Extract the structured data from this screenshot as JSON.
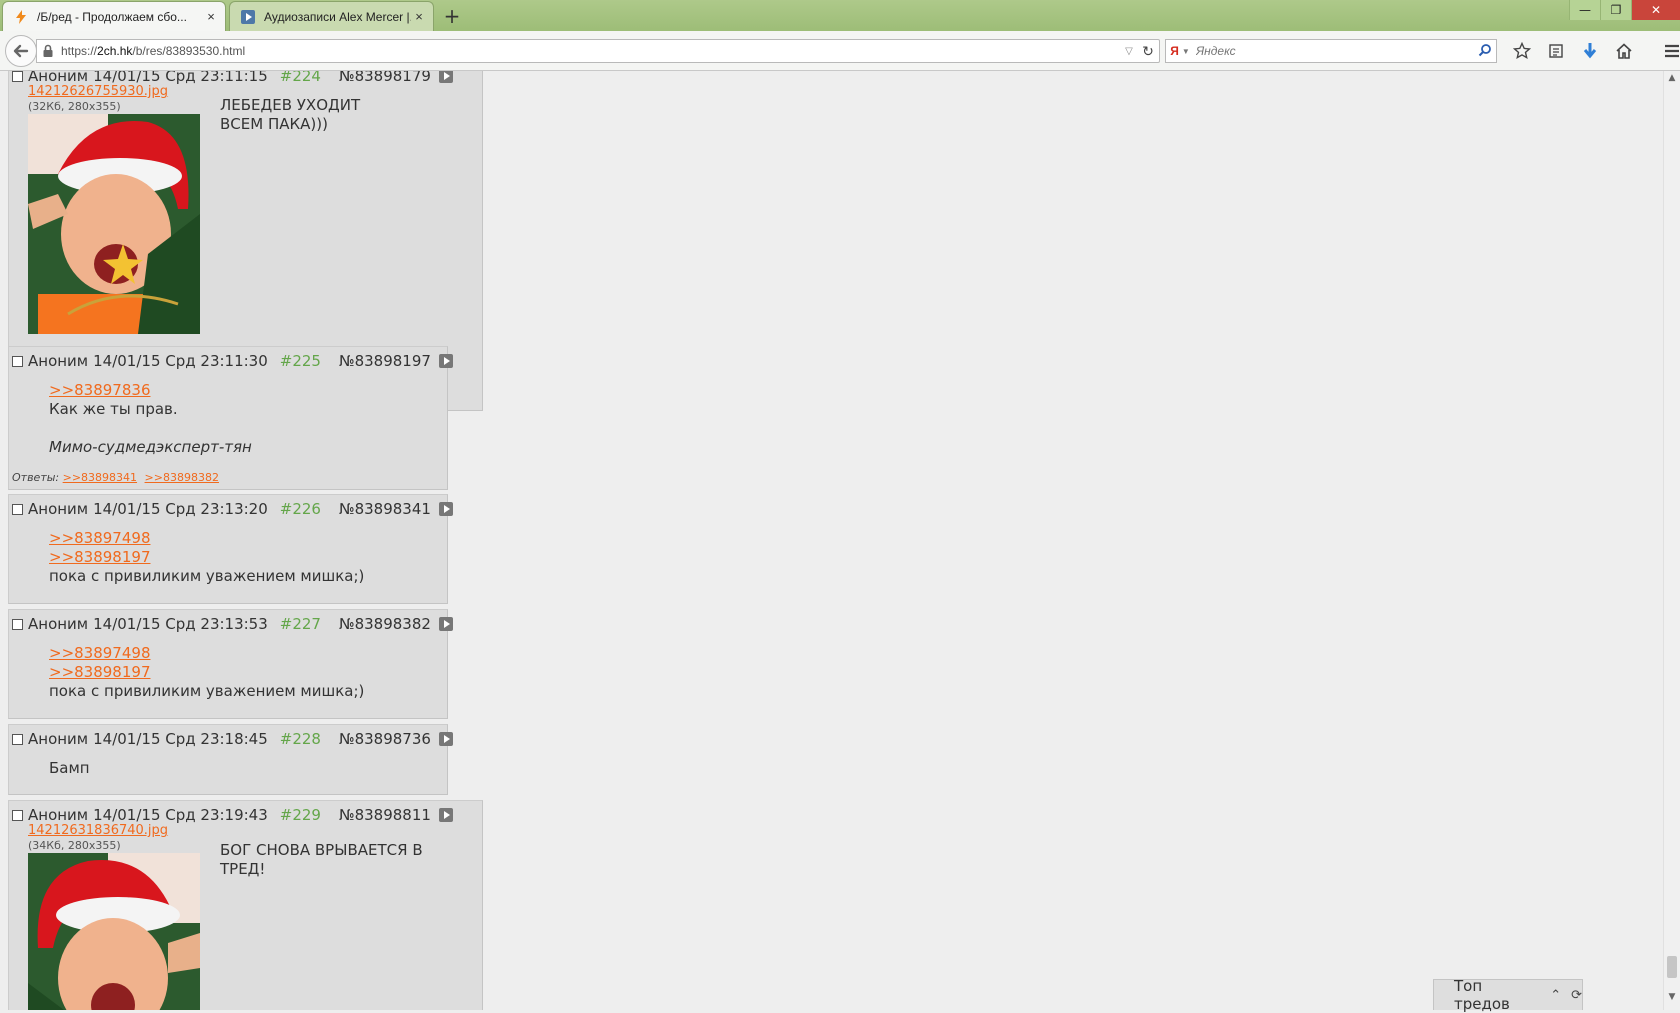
{
  "browser": {
    "tabs": [
      {
        "title": "/Б/ред - Продолжаем сбо...",
        "close": "×"
      },
      {
        "title": "Аудиозаписи Alex Mercer |...",
        "close": "×"
      }
    ],
    "new_tab": "+",
    "url_prefix": "https://",
    "url_host": "2ch.hk",
    "url_path": "/b/res/83893530.html",
    "search_placeholder": "Яндекс",
    "search_engine_letter": "Я",
    "window_buttons": {
      "minimize": "—",
      "restore": "❐",
      "close": "✕"
    }
  },
  "posts": [
    {
      "checkbox": "",
      "name": "Аноним",
      "date": "14/01/15 Срд 23:11:15",
      "num": "#224",
      "id": "№83898179",
      "file": {
        "name": "14212626755930.jpg",
        "meta": "(32Кб, 280x355)"
      },
      "lines": [
        "ЛЕБЕДЕВ УХОДИТ",
        "ВСЕМ ПАКА)))"
      ]
    },
    {
      "name": "Аноним",
      "date": "14/01/15 Срд 23:11:30",
      "num": "#225",
      "id": "№83898197",
      "refs": [
        ">>83897836"
      ],
      "text": "Как же ты прав.",
      "italic": "Мимо-судмедэксперт-тян",
      "replies_label": "Ответы:",
      "replies": [
        ">>83898341",
        ">>83898382"
      ]
    },
    {
      "name": "Аноним",
      "date": "14/01/15 Срд 23:13:20",
      "num": "#226",
      "id": "№83898341",
      "refs": [
        ">>83897498",
        ">>83898197"
      ],
      "text": "пока с привиликим уважением мишка;)"
    },
    {
      "name": "Аноним",
      "date": "14/01/15 Срд 23:13:53",
      "num": "#227",
      "id": "№83898382",
      "refs": [
        ">>83897498",
        ">>83898197"
      ],
      "text": "пока с привиликим уважением мишка;)"
    },
    {
      "name": "Аноним",
      "date": "14/01/15 Срд 23:18:45",
      "num": "#228",
      "id": "№83898736",
      "text": "Бамп"
    },
    {
      "name": "Аноним",
      "date": "14/01/15 Срд 23:19:43",
      "num": "#229",
      "id": "№83898811",
      "file": {
        "name": "14212631836740.jpg",
        "meta": "(34Кб, 280x355)"
      },
      "lines": [
        "БОГ СНОВА ВРЫВАЕТСЯ В",
        "ТРЕД!"
      ]
    }
  ],
  "top_threads": {
    "label": "Топ тредов",
    "toggle_icon": "⌃",
    "refresh_icon": "⟳"
  },
  "colors": {
    "accent_link": "#f06a1e",
    "post_num": "#64a64a",
    "post_bg": "#dddddd",
    "page_bg": "#eeeeee"
  }
}
